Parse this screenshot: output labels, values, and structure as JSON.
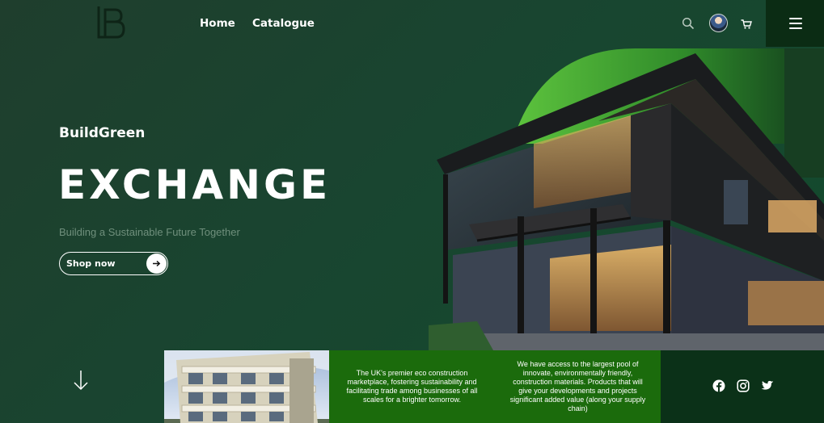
{
  "header": {
    "logo_icon": "bl-monogram-logo",
    "nav": [
      {
        "label": "Home"
      },
      {
        "label": "Catalogue"
      }
    ],
    "icons": [
      "search-icon",
      "avatar",
      "cart-icon",
      "hamburger-menu-icon"
    ]
  },
  "hero": {
    "brand": "BuildGreen",
    "title": "EXCHANGE",
    "tagline": "Building a Sustainable Future Together",
    "cta_label": "Shop now",
    "cta_icon": "arrow-right-icon"
  },
  "info": {
    "panel_1": "The UK's premier eco construction marketplace, fostering sustainability and facilitating trade among businesses of all scales for a brighter tomorrow.",
    "panel_2": "We have access to the largest pool of innovate, environmentally friendly, construction materials. Products that will give your developments and projects significant added value (along your supply chain)"
  },
  "social": [
    "facebook-icon",
    "instagram-icon",
    "twitter-icon"
  ],
  "colors": {
    "background": "#194530",
    "menu_bg": "#0b2c14",
    "info_panel": "#1b6b0c",
    "social_panel": "#0b3118",
    "accent_green": "#4caf3a",
    "tagline": "#6f8f7c"
  }
}
